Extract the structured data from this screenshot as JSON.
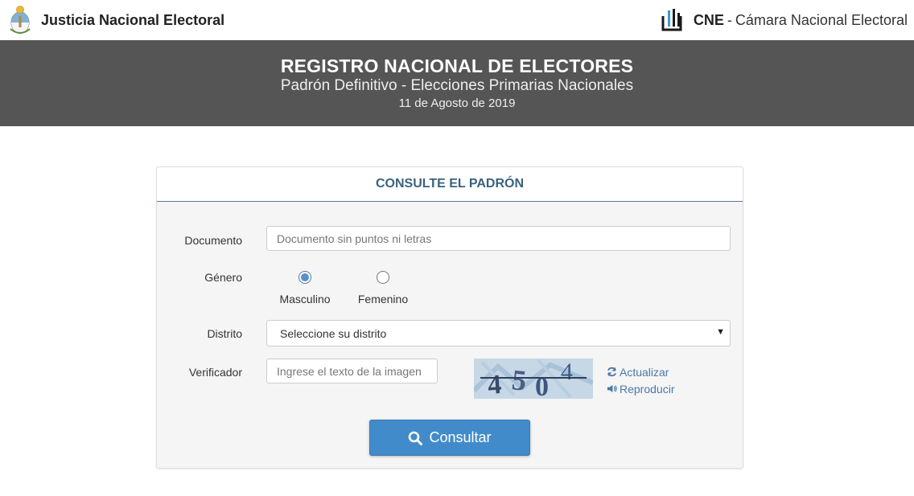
{
  "header": {
    "left_name": "Justicia Nacional Electoral",
    "right_abbr": "CNE",
    "right_sep": "-",
    "right_name": "Cámara Nacional Electoral"
  },
  "banner": {
    "title": "REGISTRO NACIONAL DE ELECTORES",
    "subtitle": "Padrón Definitivo - Elecciones Primarias Nacionales",
    "date": "11 de Agosto de 2019"
  },
  "form": {
    "heading": "CONSULTE EL PADRÓN",
    "documento": {
      "label": "Documento",
      "placeholder": "Documento sin puntos ni letras",
      "value": ""
    },
    "genero": {
      "label": "Género",
      "options": [
        {
          "label": "Masculino",
          "checked": true
        },
        {
          "label": "Femenino",
          "checked": false
        }
      ]
    },
    "distrito": {
      "label": "Distrito",
      "selected": "Seleccione su distrito"
    },
    "verificador": {
      "label": "Verificador",
      "placeholder": "Ingrese el texto de la imagen",
      "captcha_text": "4504",
      "refresh_label": "Actualizar",
      "audio_label": "Reproducir"
    },
    "submit_label": "Consultar"
  },
  "colors": {
    "banner_bg": "#555555",
    "accent": "#428bca",
    "heading": "#39627f",
    "link": "#4a7aa7"
  },
  "icons": [
    "argentina-seal-icon",
    "cne-logo-icon",
    "refresh-icon",
    "volume-icon",
    "search-icon",
    "chevron-down-icon"
  ]
}
